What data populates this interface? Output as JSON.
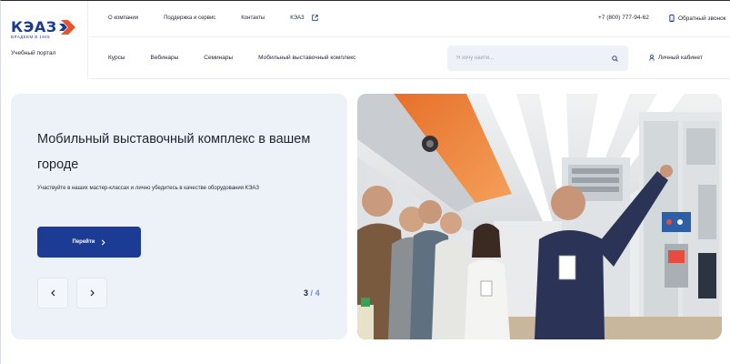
{
  "brand": {
    "logo_text": "КЭАЗ",
    "logo_tagline": "ВЛАДЕЕМ В 1945",
    "portal_label": "Учебный портал",
    "colors": {
      "primary": "#1b3b94",
      "accent": "#e8532a",
      "panel": "#edf2f8"
    }
  },
  "top_nav": {
    "items": [
      {
        "label": "О компании"
      },
      {
        "label": "Поддержка и сервис"
      },
      {
        "label": "Контакты"
      },
      {
        "label": "КЭАЗ",
        "icon": "external-link-icon"
      }
    ],
    "phone": "+7 (800) 777-94-62",
    "callback_label": "Обратный звонок"
  },
  "main_nav": {
    "items": [
      {
        "label": "Курсы"
      },
      {
        "label": "Вебинары"
      },
      {
        "label": "Семинары"
      },
      {
        "label": "Мобильный выставочный комплекс"
      }
    ]
  },
  "search": {
    "placeholder": "Я хочу найти...",
    "value": ""
  },
  "account": {
    "label": "Личный кабинет"
  },
  "hero": {
    "title": "Мобильный выставочный комплекс в вашем городе",
    "description": "Участвуйте в наших мастер-классах и лично убедитесь в качестве оборудования КЭАЗ",
    "cta_label": "Перейти",
    "slide_current": "3",
    "slide_separator": "/",
    "slide_total": "4"
  }
}
